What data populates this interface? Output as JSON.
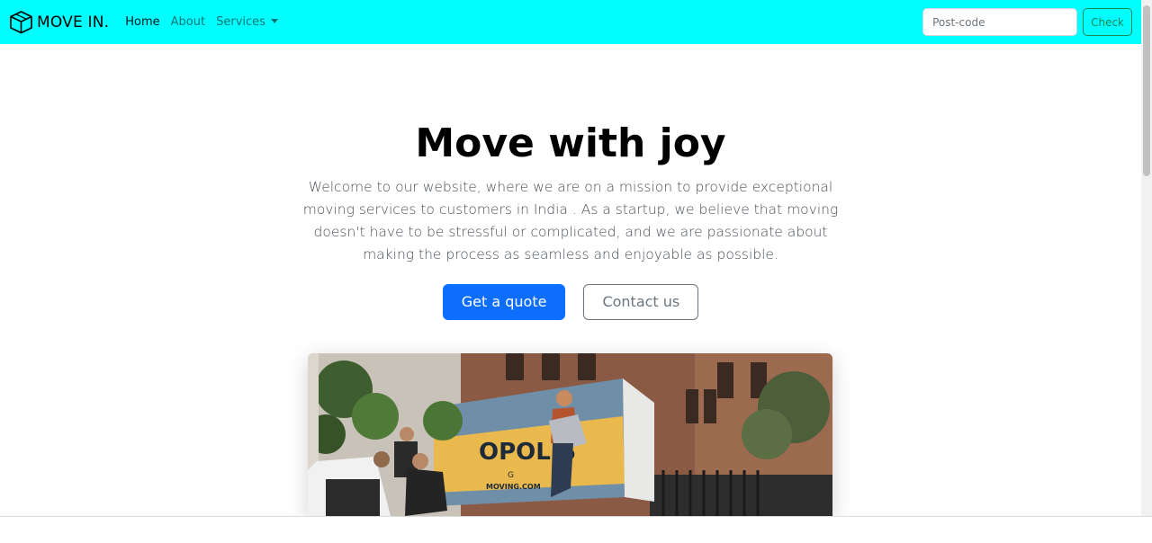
{
  "navbar": {
    "brand": "MOVE IN.",
    "brand_icon": "box-icon",
    "links": [
      {
        "label": "Home",
        "active": true
      },
      {
        "label": "About",
        "active": false
      },
      {
        "label": "Services",
        "active": false,
        "dropdown": true
      }
    ],
    "postcode_placeholder": "Post-code",
    "check_label": "Check",
    "background_color": "#00ffff"
  },
  "hero": {
    "title": "Move with joy",
    "text": "Welcome to our website, where we are on a mission to provide exceptional moving services to customers in India . As a startup, we believe that moving doesn't have to be stressful or complicated, and we are passionate about making the process as seamless and enjoyable as possible.",
    "primary_button": "Get a quote",
    "secondary_button": "Contact us",
    "primary_color": "#0d6efd"
  },
  "image": {
    "truck_text": "OPOLIS",
    "truck_url": "MOVING.COM",
    "truck_sub": "G"
  }
}
